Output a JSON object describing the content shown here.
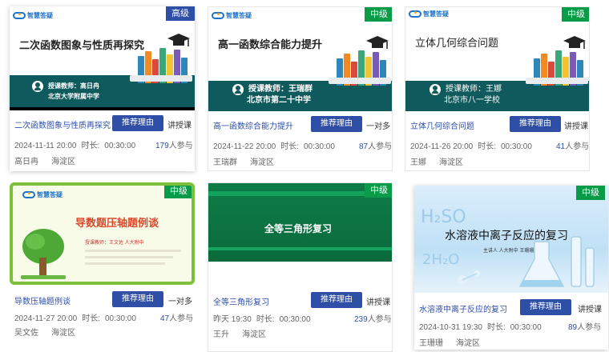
{
  "cards": [
    {
      "level": "高级",
      "logo_text": "智慧答疑",
      "slide_title": "二次函数图象与性质再探究",
      "teacher_line1": "授课教师：高日冉",
      "teacher_line2": "北京大学附属中学",
      "course_title": "二次函数图象与性质再探究",
      "recommend_label": "推荐理由",
      "type": "讲授课",
      "time": "2024-11-11 20:00",
      "duration_label": "时长:",
      "duration": "00:30:00",
      "participants": "179",
      "participants_suffix": "人参与",
      "teacher": "高日冉",
      "district": "海淀区"
    },
    {
      "level": "中级",
      "logo_text": "智慧答疑",
      "slide_title": "高一函数综合能力提升",
      "teacher_line1": "授课教师：王瑞群",
      "teacher_line2": "北京市第二十中学",
      "course_title": "高一函数综合能力提升",
      "recommend_label": "推荐理由",
      "type": "一对多",
      "time": "2024-11-22 20:00",
      "duration_label": "时长:",
      "duration": "00:30:00",
      "participants": "87",
      "participants_suffix": "人参与",
      "teacher": "王瑞群",
      "district": "海淀区"
    },
    {
      "level": "中级",
      "logo_text": "智慧答疑",
      "slide_title": "立体几何综合问题",
      "teacher_line1": "授课教师：王娜",
      "teacher_line2": "北京市八一学校",
      "course_title": "立体几何综合问题",
      "recommend_label": "推荐理由",
      "type": "讲授课",
      "time": "2024-11-26 20:00",
      "duration_label": "时长:",
      "duration": "00:30:00",
      "participants": "41",
      "participants_suffix": "人参与",
      "teacher": "王娜",
      "district": "海淀区"
    },
    {
      "level": "中级",
      "logo_text": "智慧答疑",
      "slide_title": "导数题压轴题例谈",
      "slide_sub": "授课教师：王文佐   人大附中",
      "course_title": "导数压轴题例谈",
      "recommend_label": "推荐理由",
      "type": "一对多",
      "time": "2024-11-27 20:00",
      "duration_label": "时长:",
      "duration": "00:30:00",
      "participants": "47",
      "participants_suffix": "人参与",
      "teacher": "吴文佐",
      "district": "海淀区"
    },
    {
      "level": "中级",
      "slide_title": "全等三角形复习",
      "course_title": "全等三角形复习",
      "recommend_label": "推荐理由",
      "type": "讲授课",
      "time": "昨天 19:30",
      "duration_label": "时长:",
      "duration": "00:30:00",
      "participants": "239",
      "participants_suffix": "人参与",
      "teacher": "王升",
      "district": "海淀区"
    },
    {
      "level": "中级",
      "slide_title": "水溶液中离子反应的复习",
      "slide_sub": "主讲人 人大附中 王珊珊",
      "course_title": "水溶液中离子反应的复习",
      "recommend_label": "推荐理由",
      "type": "讲授课",
      "time": "2024-10-31 19:30",
      "duration_label": "时长:",
      "duration": "00:30:00",
      "participants": "89",
      "participants_suffix": "人参与",
      "teacher": "王珊珊",
      "district": "海淀区"
    }
  ],
  "colors": {
    "accent": "#2f4fa7",
    "level_green": "#0a9b48",
    "teal": "#0f5a5c"
  }
}
